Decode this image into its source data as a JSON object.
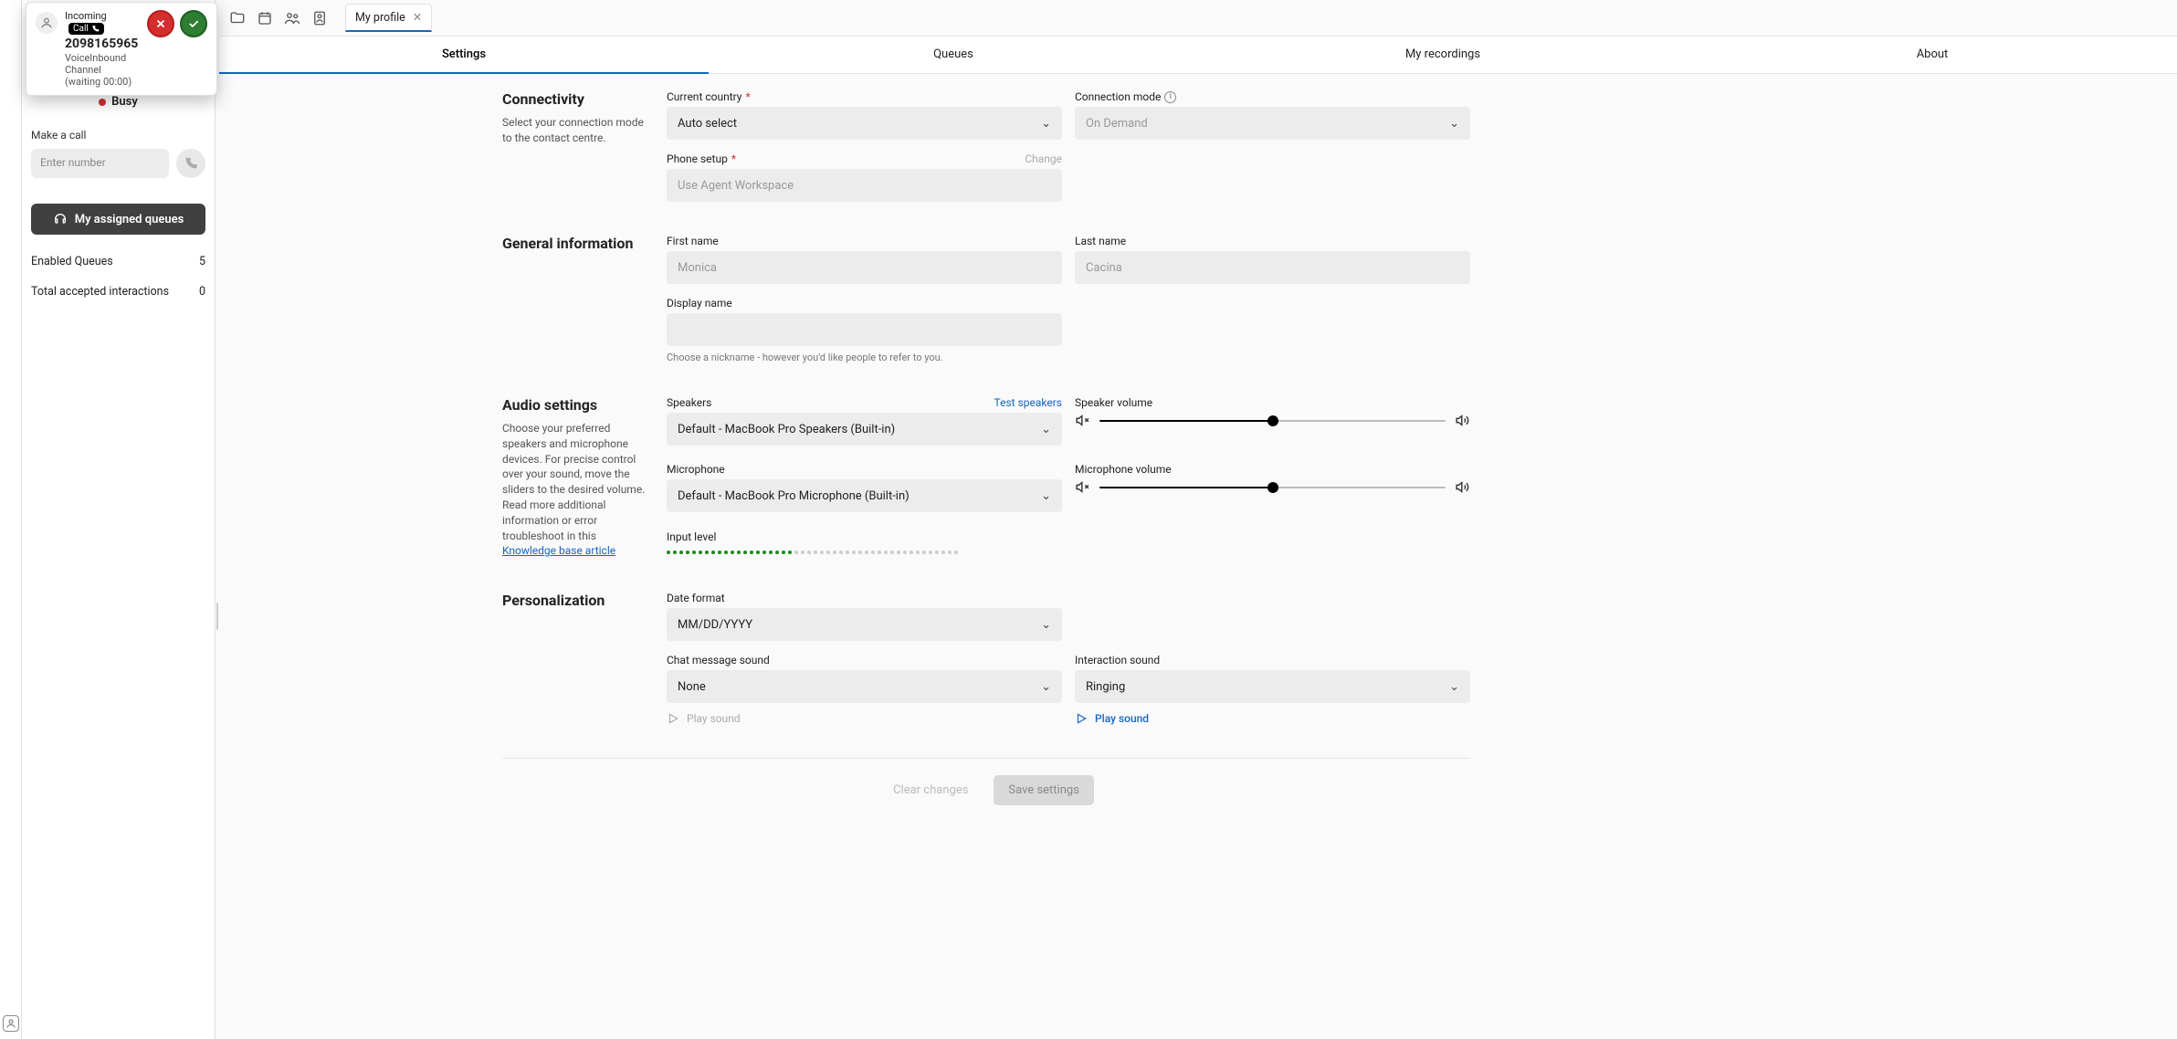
{
  "incoming": {
    "label": "Incoming",
    "badge": "Call",
    "number": "2098165965",
    "channel": "VoiceInbound Channel",
    "waiting": "(waiting 00:00)"
  },
  "status": {
    "text": "Busy"
  },
  "make_call": {
    "label": "Make a call",
    "placeholder": "Enter number"
  },
  "queues_btn": "My assigned queues",
  "stats": {
    "enabled_label": "Enabled Queues",
    "enabled_val": "5",
    "accepted_label": "Total accepted interactions",
    "accepted_val": "0"
  },
  "tab": {
    "label": "My profile"
  },
  "subtabs": {
    "settings": "Settings",
    "queues": "Queues",
    "recordings": "My recordings",
    "about": "About"
  },
  "connectivity": {
    "title": "Connectivity",
    "desc": "Select your connection mode to the contact centre.",
    "country_label": "Current country",
    "country_val": "Auto select",
    "mode_label": "Connection mode",
    "mode_val": "On Demand",
    "phone_label": "Phone setup",
    "phone_change": "Change",
    "phone_val": "Use Agent Workspace"
  },
  "general": {
    "title": "General information",
    "first_label": "First name",
    "first_val": "Monica",
    "last_label": "Last name",
    "last_val": "Cacina",
    "display_label": "Display name",
    "display_help": "Choose a nickname - however you'd like people to refer to you."
  },
  "audio": {
    "title": "Audio settings",
    "desc1": "Choose your preferred speakers and microphone devices. For precise control over your sound, move the sliders to the desired volume. Read more additional information or error troubleshoot in this ",
    "kb_link": "Knowledge base article",
    "speakers_label": "Speakers",
    "test_speakers": "Test speakers",
    "speakers_val": "Default - MacBook Pro Speakers (Built-in)",
    "speaker_vol_label": "Speaker volume",
    "mic_label": "Microphone",
    "mic_val": "Default - MacBook Pro Microphone (Built-in)",
    "mic_vol_label": "Microphone volume",
    "input_label": "Input level"
  },
  "personalization": {
    "title": "Personalization",
    "date_label": "Date format",
    "date_val": "MM/DD/YYYY",
    "chat_label": "Chat message sound",
    "chat_val": "None",
    "interaction_label": "Interaction sound",
    "interaction_val": "Ringing",
    "play_sound": "Play sound"
  },
  "footer": {
    "clear": "Clear changes",
    "save": "Save settings"
  }
}
